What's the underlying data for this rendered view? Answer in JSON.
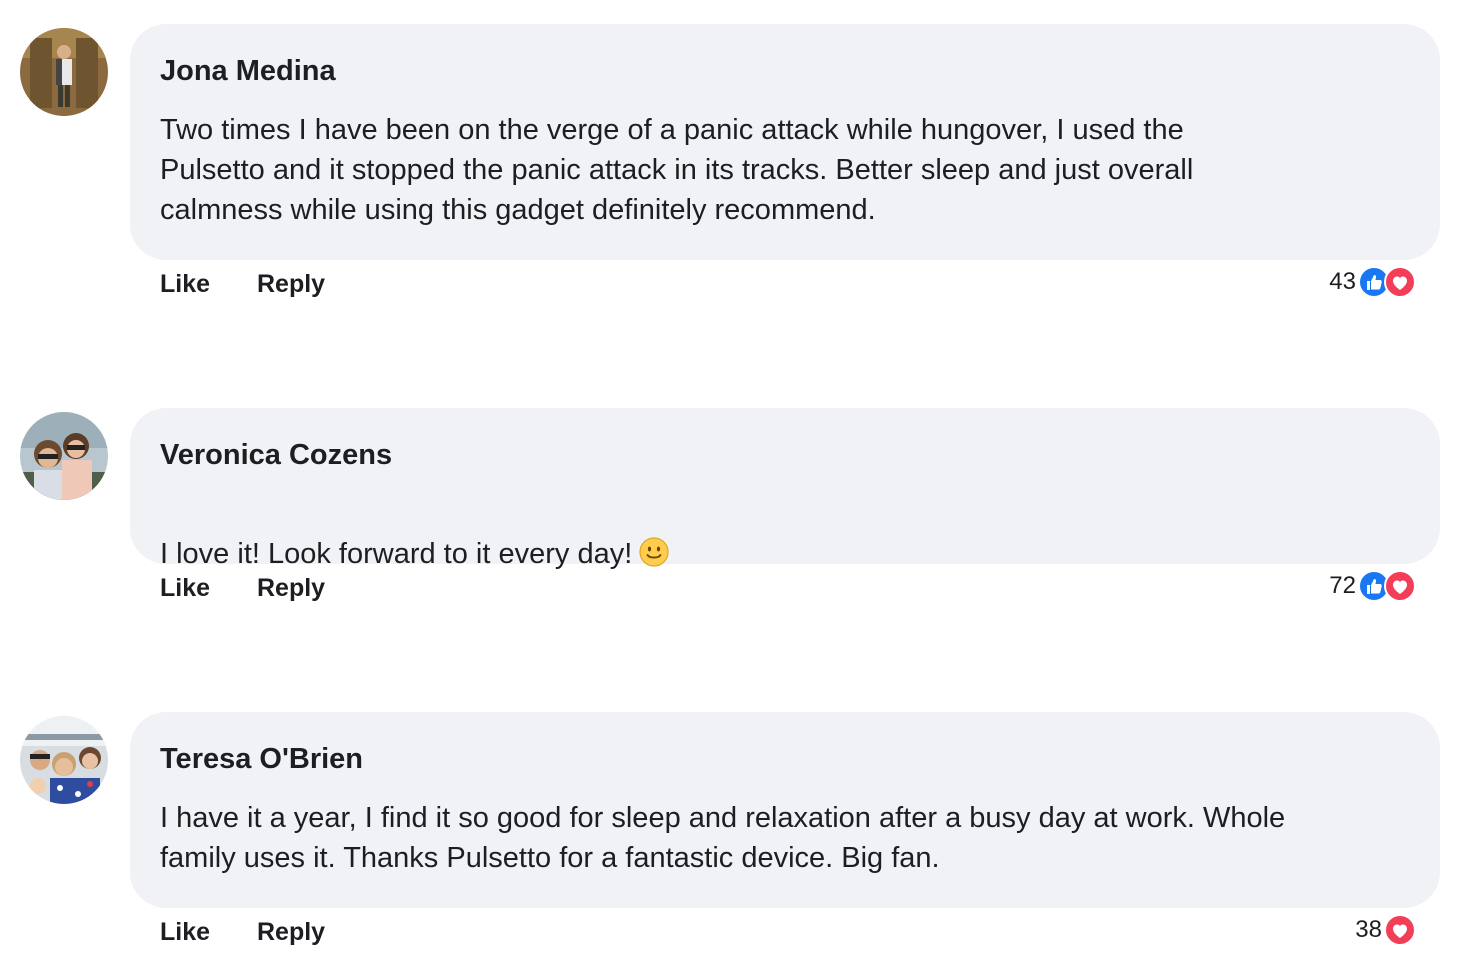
{
  "comments": [
    {
      "author": "Jona Medina",
      "text": "Two times I have been on the verge of a panic attack while hungover, I used the\nPulsetto and it stopped the panic attack in its tracks. Better sleep and just overall\ncalmness while using this gadget definitely recommend.",
      "like_label": "Like",
      "reply_label": "Reply",
      "reaction_count": "43",
      "reactions": [
        "like-icon",
        "heart-icon"
      ]
    },
    {
      "author": "Veronica Cozens",
      "text": "I love it! Look forward to it every day!",
      "emoji": "smile-emoji",
      "like_label": "Like",
      "reply_label": "Reply",
      "reaction_count": "72",
      "reactions": [
        "like-icon",
        "heart-icon"
      ]
    },
    {
      "author": "Teresa O'Brien",
      "text": "I have it a year, I find it so good for sleep and relaxation after a busy day at work. Whole\nfamily uses it. Thanks Pulsetto for a fantastic device. Big fan.",
      "like_label": "Like",
      "reply_label": "Reply",
      "reaction_count": "38",
      "reactions": [
        "heart-icon"
      ]
    }
  ],
  "colors": {
    "bubble": "#f0f2f5",
    "like_blue": "#1877f2",
    "heart_red": "#f33e58",
    "text": "#1c1e21"
  }
}
